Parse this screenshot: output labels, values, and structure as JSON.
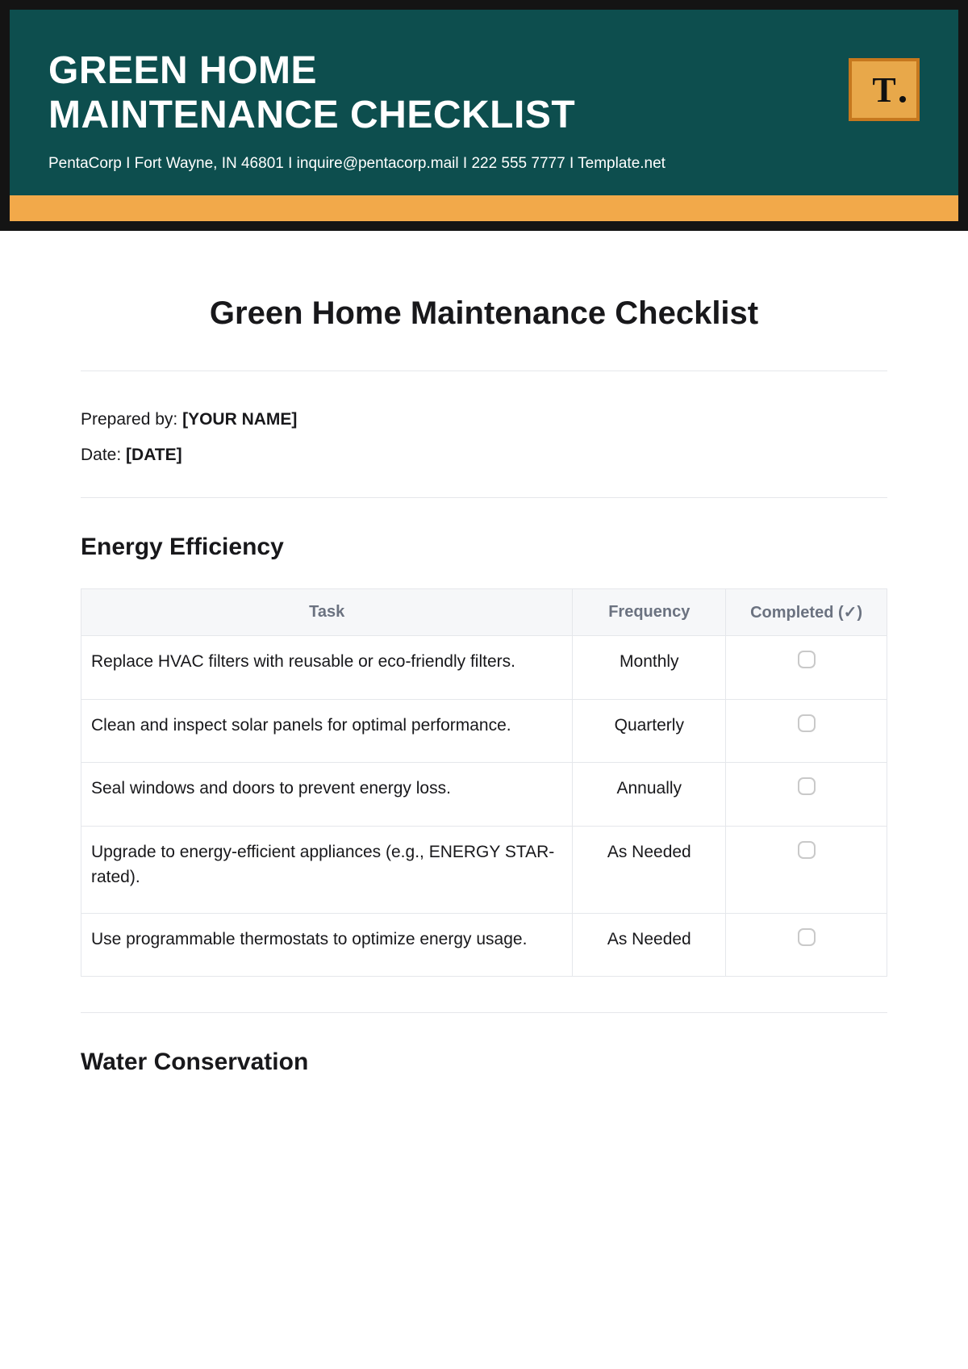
{
  "header": {
    "title_line1": "GREEN HOME",
    "title_line2": "MAINTENANCE CHECKLIST",
    "subline": "PentaCorp I  Fort Wayne, IN 46801 I inquire@pentacorp.mail  I 222 555 7777 I Template.net",
    "logo_text": "T"
  },
  "doc": {
    "title": "Green Home Maintenance Checklist",
    "prepared_by_label": "Prepared by: ",
    "prepared_by_value": "[YOUR NAME]",
    "date_label": "Date: ",
    "date_value": "[DATE]"
  },
  "table_headers": {
    "task": "Task",
    "frequency": "Frequency",
    "completed": "Completed (✓)"
  },
  "sections": [
    {
      "title": "Energy Efficiency",
      "rows": [
        {
          "task": "Replace HVAC filters with reusable or eco-friendly filters.",
          "frequency": "Monthly"
        },
        {
          "task": "Clean and inspect solar panels for optimal performance.",
          "frequency": "Quarterly"
        },
        {
          "task": "Seal windows and doors to prevent energy loss.",
          "frequency": "Annually"
        },
        {
          "task": "Upgrade to energy-efficient appliances (e.g., ENERGY STAR-rated).",
          "frequency": "As Needed"
        },
        {
          "task": "Use programmable thermostats to optimize energy usage.",
          "frequency": "As Needed"
        }
      ]
    },
    {
      "title": "Water Conservation",
      "rows": []
    }
  ]
}
